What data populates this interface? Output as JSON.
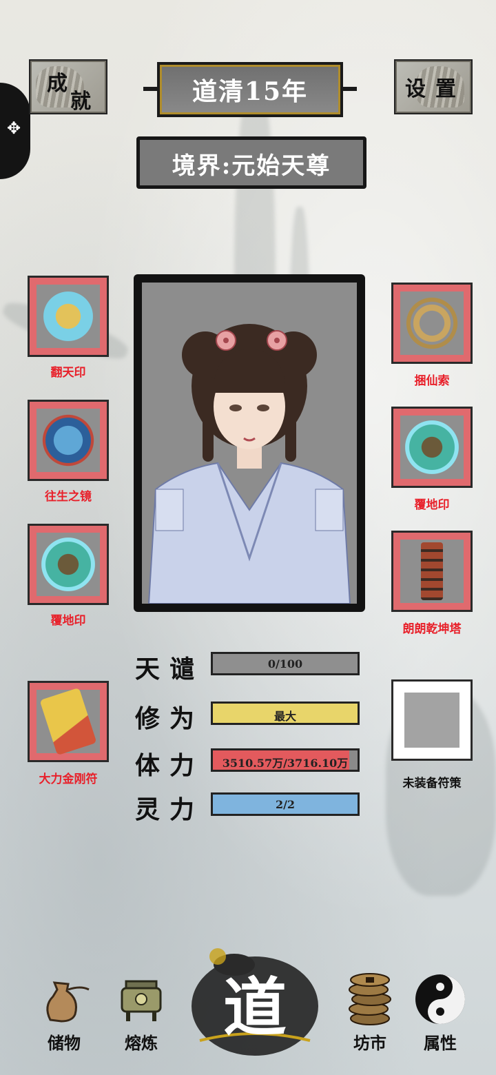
{
  "header": {
    "achievements_label_1": "成",
    "achievements_label_2": "就",
    "settings_label_1": "设",
    "settings_label_2": "置",
    "year_title": "道清15年",
    "realm_title": "境界:元始天尊"
  },
  "left_equipment": [
    {
      "label": "翻天印",
      "icon": "dragon-seal-icon"
    },
    {
      "label": "往生之镜",
      "icon": "mirror-icon"
    },
    {
      "label": "覆地印",
      "icon": "turtle-seal-icon"
    },
    {
      "label": "大力金刚符",
      "icon": "talisman-icon"
    }
  ],
  "right_equipment": [
    {
      "label": "捆仙索",
      "icon": "rope-icon"
    },
    {
      "label": "覆地印",
      "icon": "turtle-seal-icon"
    },
    {
      "label": "朗朗乾坤塔",
      "icon": "pagoda-icon"
    },
    {
      "label": "未装备符策",
      "icon": "empty-slot"
    }
  ],
  "stats": [
    {
      "label": "天谴",
      "value_text": "0/100",
      "fraction": 0.0,
      "color": "#8f8f8f"
    },
    {
      "label": "修为",
      "value_text": "最大",
      "fraction": 1.0,
      "color": "#e8d56a"
    },
    {
      "label": "体力",
      "value_text": "3510.57万/3716.10万",
      "fraction": 0.945,
      "color": "#e35a5d"
    },
    {
      "label": "灵力",
      "value_text": "2/2",
      "fraction": 1.0,
      "color": "#7fb4de"
    }
  ],
  "bottom_nav": [
    {
      "label": "储物",
      "icon": "pouch-icon"
    },
    {
      "label": "熔炼",
      "icon": "cauldron-icon"
    },
    {
      "label": "道",
      "icon": "dao-emblem"
    },
    {
      "label": "坊市",
      "icon": "coins-icon"
    },
    {
      "label": "属性",
      "icon": "yin-yang-icon"
    }
  ],
  "colors": {
    "slot_border": "#e06a6e",
    "label_red": "#e8202a",
    "frame_gold": "#c8a21c"
  }
}
